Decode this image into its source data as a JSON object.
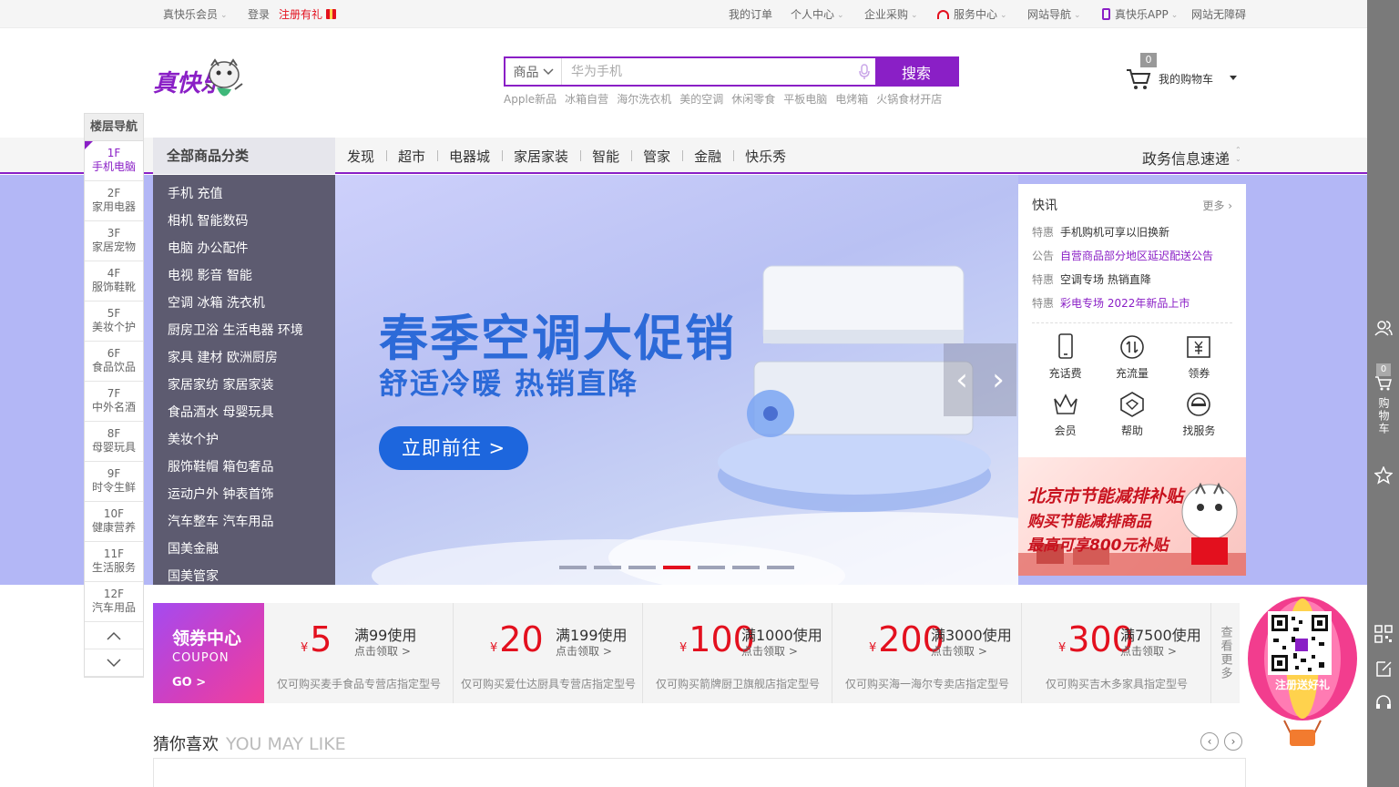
{
  "topbar": {
    "member": "真快乐会员",
    "login": "登录",
    "register": "注册有礼",
    "orders": "我的订单",
    "personal": "个人中心",
    "enterprise": "企业采购",
    "service": "服务中心",
    "site_nav": "网站导航",
    "app": "真快乐APP",
    "accessibility": "网站无障碍"
  },
  "logo": {
    "text": "真快乐"
  },
  "search": {
    "category": "商品",
    "placeholder": "华为手机",
    "button": "搜索",
    "hotwords": [
      "Apple新品",
      "冰箱自营",
      "海尔洗衣机",
      "美的空调",
      "休闲零食",
      "平板电脑",
      "电烤箱",
      "火锅食材开店"
    ]
  },
  "cart": {
    "count": "0",
    "label": "我的购物车"
  },
  "nav": {
    "all_categories": "全部商品分类",
    "items": [
      "发现",
      "超市",
      "电器城",
      "家居家装",
      "智能",
      "管家",
      "金融",
      "快乐秀"
    ],
    "gov_news": "政务信息速递"
  },
  "floor_nav": {
    "title": "楼层导航",
    "floors": [
      {
        "num": "1F",
        "name": "手机电脑"
      },
      {
        "num": "2F",
        "name": "家用电器"
      },
      {
        "num": "3F",
        "name": "家居宠物"
      },
      {
        "num": "4F",
        "name": "服饰鞋靴"
      },
      {
        "num": "5F",
        "name": "美妆个护"
      },
      {
        "num": "6F",
        "name": "食品饮品"
      },
      {
        "num": "7F",
        "name": "中外名酒"
      },
      {
        "num": "8F",
        "name": "母婴玩具"
      },
      {
        "num": "9F",
        "name": "时令生鲜"
      },
      {
        "num": "10F",
        "name": "健康营养"
      },
      {
        "num": "11F",
        "name": "生活服务"
      },
      {
        "num": "12F",
        "name": "汽车用品"
      }
    ]
  },
  "categories": [
    "手机 充值",
    "相机 智能数码",
    "电脑 办公配件",
    "电视 影音 智能",
    "空调 冰箱 洗衣机",
    "厨房卫浴 生活电器 环境",
    "家具 建材 欧洲厨房",
    "家居家纺 家居家装",
    "食品酒水 母婴玩具",
    "美妆个护",
    "服饰鞋帽 箱包奢品",
    "运动户外 钟表首饰",
    "汽车整车 汽车用品",
    "国美金融",
    "国美管家"
  ],
  "banner": {
    "headline": "春季空调大促销",
    "subline": "舒适冷暖  热销直降",
    "cta": "立即前往 >",
    "prev": "‹",
    "next": "›",
    "slide_count": 7,
    "active_slide": 4
  },
  "news": {
    "title": "快讯",
    "more": "更多",
    "items": [
      {
        "tag": "特惠",
        "text": "手机购机可享以旧换新"
      },
      {
        "tag": "公告",
        "text": "自营商品部分地区延迟配送公告"
      },
      {
        "tag": "特惠",
        "text": "空调专场 热销直降"
      },
      {
        "tag": "特惠",
        "text": "彩电专场 2022年新品上市"
      }
    ],
    "quick": [
      "充话费",
      "充流量",
      "领券",
      "会员",
      "帮助",
      "找服务"
    ]
  },
  "promo": {
    "line1": "北京市节能减排补贴",
    "line2": "购买节能减排商品",
    "line3": "最高可享800元补贴"
  },
  "coupon_center": {
    "title": "领券中心",
    "subtitle": "COUPON",
    "go": "GO >",
    "coupons": [
      {
        "amount": "5",
        "condition": "满99使用",
        "action": "点击领取 >",
        "desc": "仅可购买麦手食品专营店指定型号"
      },
      {
        "amount": "20",
        "condition": "满199使用",
        "action": "点击领取 >",
        "desc": "仅可购买爱仕达厨具专营店指定型号"
      },
      {
        "amount": "100",
        "condition": "满1000使用",
        "action": "点击领取 >",
        "desc": "仅可购买箭牌厨卫旗舰店指定型号"
      },
      {
        "amount": "200",
        "condition": "满3000使用",
        "action": "点击领取 >",
        "desc": "仅可购买海一海尔专卖店指定型号"
      },
      {
        "amount": "300",
        "condition": "满7500使用",
        "action": "点击领取 >",
        "desc": "仅可购买吉木多家具指定型号"
      }
    ],
    "currency": "¥",
    "more": "查看更多"
  },
  "guess": {
    "title": "猜你喜欢",
    "subtitle": "YOU MAY LIKE",
    "prev": "‹",
    "next": "›"
  },
  "sidebar": {
    "cart_label": "购物车",
    "cart_count": "0"
  },
  "balloon": {
    "text": "注册送好礼"
  },
  "colors": {
    "brand": "#8a1fc6",
    "red": "#e3101e",
    "banner_blue": "#2c6ad8"
  }
}
